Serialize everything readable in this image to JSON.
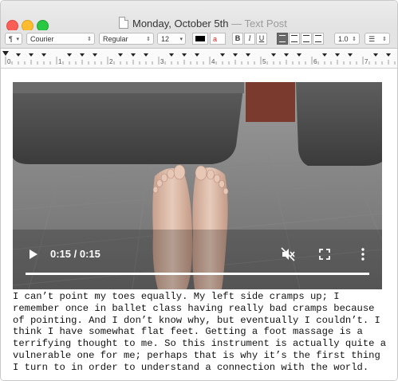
{
  "window": {
    "title": "Monday, October 5th",
    "subtitle": "— Text Post"
  },
  "toolbar": {
    "paragraph_style": "¶",
    "font_family": "Courier",
    "font_style": "Regular",
    "font_size": "12",
    "bold": "B",
    "italic": "I",
    "underline": "U",
    "line_spacing": "1.0",
    "text_color": "#000000"
  },
  "ruler": {
    "numbers": [
      "0",
      "1",
      "2",
      "3",
      "4",
      "5",
      "6",
      "7"
    ]
  },
  "video": {
    "time": "0:15 / 0:15",
    "progress": 1.0,
    "controls": [
      "play-icon",
      "mute-icon",
      "fullscreen-icon",
      "more-icon"
    ]
  },
  "body": {
    "lines": [
      "I can’t point my toes equally. My left side cramps up; I",
      "remember once in ballet class having really bad cramps because",
      "of pointing. And I don’t know why, but eventually I couldn’t. I",
      "think I have somewhat flat feet. Getting a foot massage is a",
      "terrifying thought to me. So this instrument is actually quite a",
      "vulnerable one for me; perhaps that is why it’s the first thing",
      "I turn to in order to understand a connection with the world."
    ]
  }
}
